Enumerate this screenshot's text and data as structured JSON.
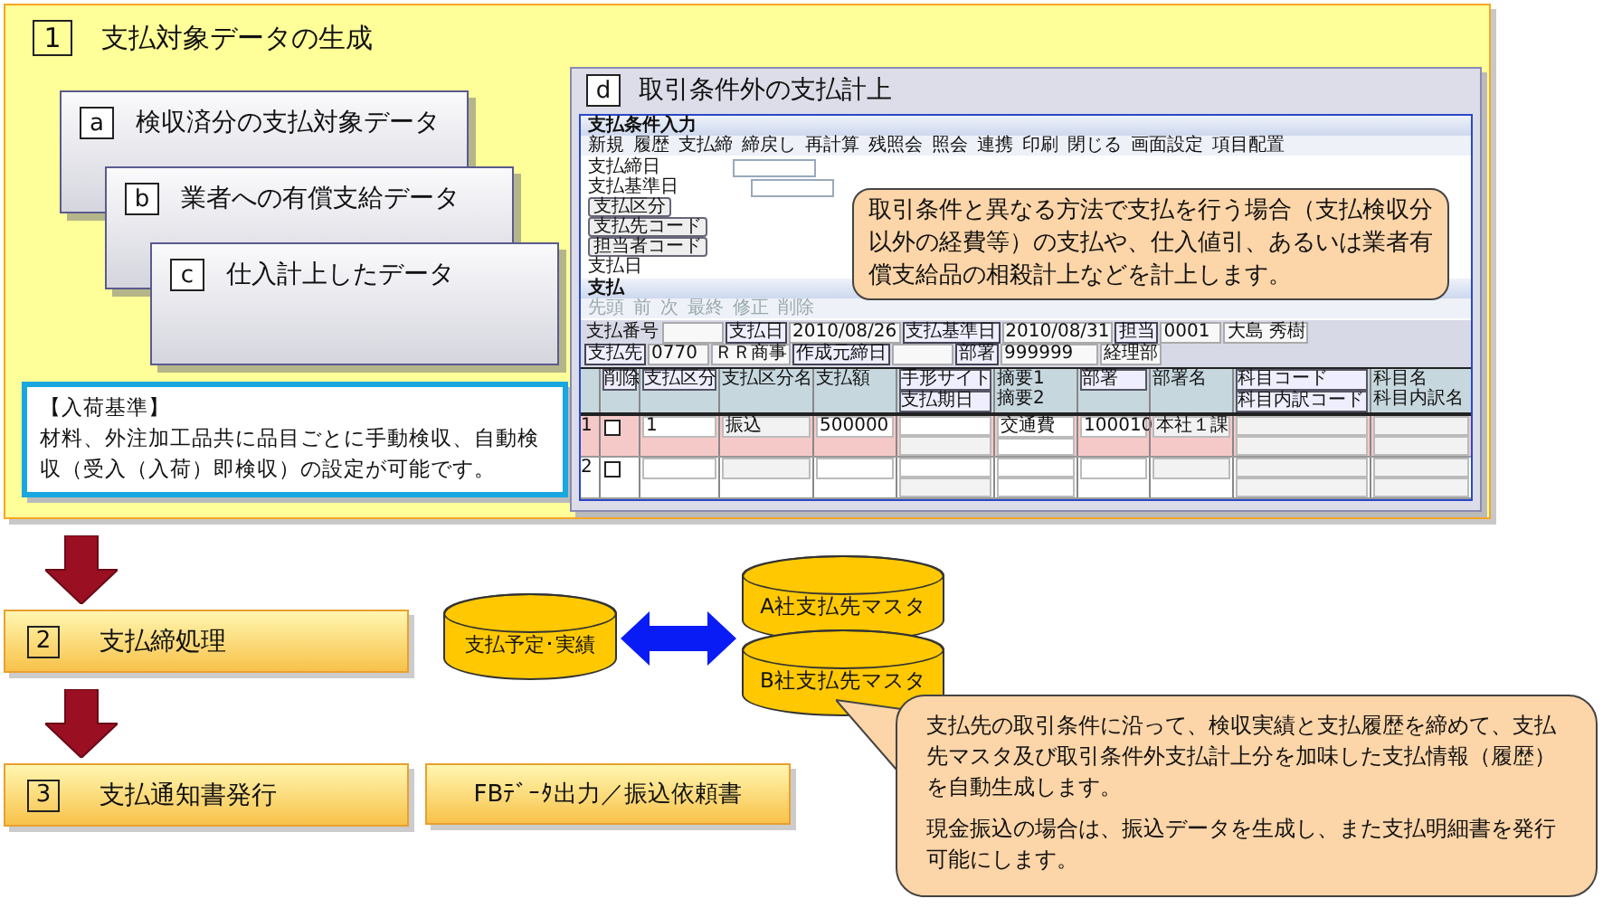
{
  "section1": {
    "number": "1",
    "title": "支払対象データの生成",
    "cards": [
      {
        "letter": "a",
        "title": "検収済分の支払対象データ"
      },
      {
        "letter": "b",
        "title": "業者への有償支給データ"
      },
      {
        "letter": "c",
        "title": "仕入計上したデータ"
      }
    ],
    "note": {
      "heading": "【入荷基準】",
      "text": "材料、外注加工品共に品目ごとに手動検収、自動検収（受入（入荷）即検収）の設定が可能です。"
    },
    "panel_d": {
      "letter": "d",
      "title": "取引条件外の支払計上",
      "app": {
        "title": "支払条件入力",
        "toolbar": [
          "新規",
          "履歴",
          "支払締",
          "締戻し",
          "再計算",
          "残照会",
          "照会",
          "連携",
          "印刷",
          "閉じる",
          "画面設定",
          "項目配置"
        ],
        "fields": [
          {
            "label": "支払締日",
            "kind": "input"
          },
          {
            "label": "支払基準日",
            "kind": "input"
          },
          {
            "label": "支払区分",
            "kind": "button"
          },
          {
            "label": "支払先コード",
            "kind": "button"
          },
          {
            "label": "担当者コード",
            "kind": "button"
          },
          {
            "label": "支払日",
            "kind": "text"
          }
        ],
        "section": "支払",
        "nav": [
          {
            "label": "先頭",
            "disabled": true
          },
          {
            "label": "前",
            "disabled": true
          },
          {
            "label": "次",
            "disabled": true
          },
          {
            "label": "最終",
            "disabled": true
          },
          {
            "label": "修正",
            "disabled": true
          },
          {
            "label": "削除",
            "disabled": true
          }
        ],
        "header_rows": [
          [
            {
              "kind": "label",
              "text": "支払番号"
            },
            {
              "kind": "value"
            },
            {
              "kind": "button",
              "text": "支払日"
            },
            {
              "kind": "value",
              "text": "2010/08/26"
            },
            {
              "kind": "button",
              "text": "支払基準日"
            },
            {
              "kind": "value",
              "text": "2010/08/31"
            },
            {
              "kind": "button",
              "text": "担当"
            },
            {
              "kind": "value",
              "text": "0001"
            },
            {
              "kind": "value",
              "text": "大島 秀樹"
            }
          ],
          [
            {
              "kind": "button",
              "text": "支払先"
            },
            {
              "kind": "value",
              "text": "0770"
            },
            {
              "kind": "value",
              "text": "ＲＲ商事"
            },
            {
              "kind": "button",
              "text": "作成元締日"
            },
            {
              "kind": "value"
            },
            {
              "kind": "button",
              "text": "部署"
            },
            {
              "kind": "value",
              "text": "999999"
            },
            {
              "kind": "value",
              "text": "経理部"
            }
          ]
        ],
        "columns": [
          {
            "top": "削除",
            "kind": "button"
          },
          {
            "top": "支払区分",
            "kind": "button"
          },
          {
            "top": "支払区分名",
            "kind": "label"
          },
          {
            "top": "支払額",
            "kind": "label"
          },
          {
            "top": "手形サイト",
            "bottom": "支払期日",
            "kind": "button"
          },
          {
            "top": "摘要1",
            "bottom": "摘要2",
            "kind": "label"
          },
          {
            "top": "部署",
            "kind": "button"
          },
          {
            "top": "部署名",
            "kind": "label"
          },
          {
            "top": "科目コード",
            "bottom": "科目内訳コード",
            "kind": "button"
          },
          {
            "top": "科目名",
            "bottom": "科目内訳名",
            "kind": "label"
          }
        ],
        "rows": [
          {
            "number": "1",
            "selected": true,
            "checked": false,
            "kubun": "1",
            "kubun_name": "振込",
            "amount": "500000",
            "memo": "交通費",
            "dept": "100010",
            "dept_name": "本社１課"
          },
          {
            "number": "2",
            "selected": false,
            "checked": false
          }
        ]
      },
      "callout": "取引条件と異なる方法で支払を行う場合（支払検収分以外の経費等）の支払や、仕入値引、あるいは業者有償支給品の相殺計上などを計上します。"
    }
  },
  "steps": [
    {
      "number": "2",
      "title": "支払締処理"
    },
    {
      "number": "3",
      "title": "支払通知書発行"
    }
  ],
  "databases": [
    {
      "label": "支払予定･実績"
    },
    {
      "label": "A社支払先マスタ"
    },
    {
      "label": "B社支払先マスタ"
    }
  ],
  "output": "FBﾃﾞｰﾀ出力／振込依頼書",
  "callout": [
    "支払先の取引条件に沿って、検収実績と支払履歴を締めて、支払先マスタ及び取引条件外支払計上分を加味した支払情報（履歴）を自動生成します。",
    "現金振込の場合は、振込データを生成し、また支払明細書を発行可能にします。"
  ]
}
